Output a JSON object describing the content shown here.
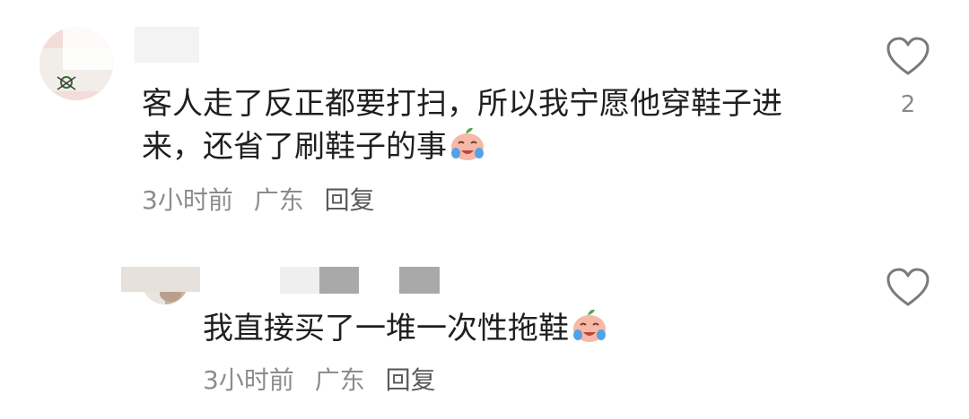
{
  "comments": [
    {
      "text": "客人走了反正都要打扫，所以我宁愿他穿鞋子进来，还省了刷鞋子的事",
      "emoji": "crying-laughing-peach-emoji",
      "time": "3小时前",
      "location": "广东",
      "reply_label": "回复",
      "like_count": "2",
      "like_icon": "heart-outline-icon"
    },
    {
      "text": "我直接买了一堆一次性拖鞋",
      "emoji": "crying-laughing-peach-emoji",
      "time": "3小时前",
      "location": "广东",
      "reply_label": "回复",
      "like_count": "",
      "like_icon": "heart-outline-icon"
    }
  ],
  "colors": {
    "text": "#1f1f1f",
    "meta": "#8c8c8c",
    "icon": "#7a7a7a"
  }
}
